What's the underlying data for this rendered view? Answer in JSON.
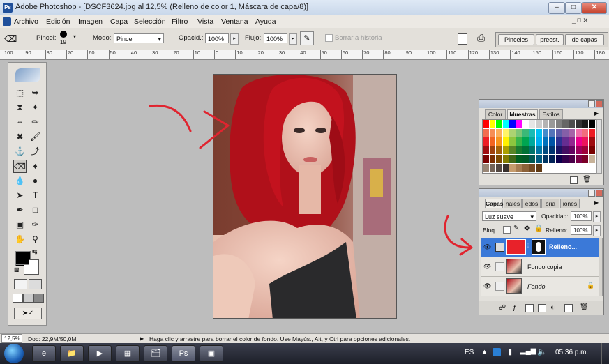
{
  "window": {
    "title": "Adobe Photoshop - [DSCF3624.jpg al 12,5% (Relleno de color 1, Máscara de capa/8)]"
  },
  "menu": [
    "Archivo",
    "Edición",
    "Imagen",
    "Capa",
    "Selección",
    "Filtro",
    "Vista",
    "Ventana",
    "Ayuda"
  ],
  "options": {
    "brush_label": "Pincel:",
    "brush_size": "19",
    "mode_label": "Modo:",
    "mode_value": "Pincel",
    "opacity_label": "Opacid.:",
    "opacity_value": "100%",
    "flow_label": "Flujo:",
    "flow_value": "100%",
    "history_label": "Borrar a historia",
    "palette_tabs": [
      "Pinceles",
      "preest.",
      "de capas"
    ]
  },
  "ruler_ticks": [
    "100",
    "90",
    "80",
    "70",
    "60",
    "50",
    "40",
    "30",
    "20",
    "10",
    "0",
    "10",
    "20",
    "30",
    "40",
    "50",
    "60",
    "70",
    "80",
    "90",
    "100",
    "110",
    "120",
    "130",
    "140",
    "150",
    "160",
    "170",
    "180"
  ],
  "swatches_panel": {
    "tabs": [
      "Color",
      "Muestras",
      "Estilos"
    ]
  },
  "layers_panel": {
    "tabs": [
      "Capas",
      "nales",
      "edos",
      "oria",
      "iones"
    ],
    "blend_mode": "Luz suave",
    "opacity_label": "Opacidad:",
    "opacity_value": "100%",
    "lock_label": "Bloq.:",
    "fill_label": "Relleno:",
    "fill_value": "100%",
    "layers": [
      {
        "name": "Relleno...",
        "selected": true
      },
      {
        "name": "Fondo copia",
        "selected": false
      },
      {
        "name": "Fondo",
        "selected": false
      }
    ]
  },
  "status": {
    "zoom": "12,5%",
    "doc": "Doc: 22,9M/50,0M",
    "hint": "Haga clic y arrastre para borrar el color de fondo. Use Mayús., Alt, y Ctrl para opciones adicionales."
  },
  "taskbar": {
    "lang": "ES",
    "clock": "05:36 p.m."
  },
  "colors": {
    "foreground": "#000000",
    "background": "#ffffff",
    "annotation": "#e0242f",
    "fill_layer": "#e8222a",
    "selection": "#3b79d8"
  }
}
